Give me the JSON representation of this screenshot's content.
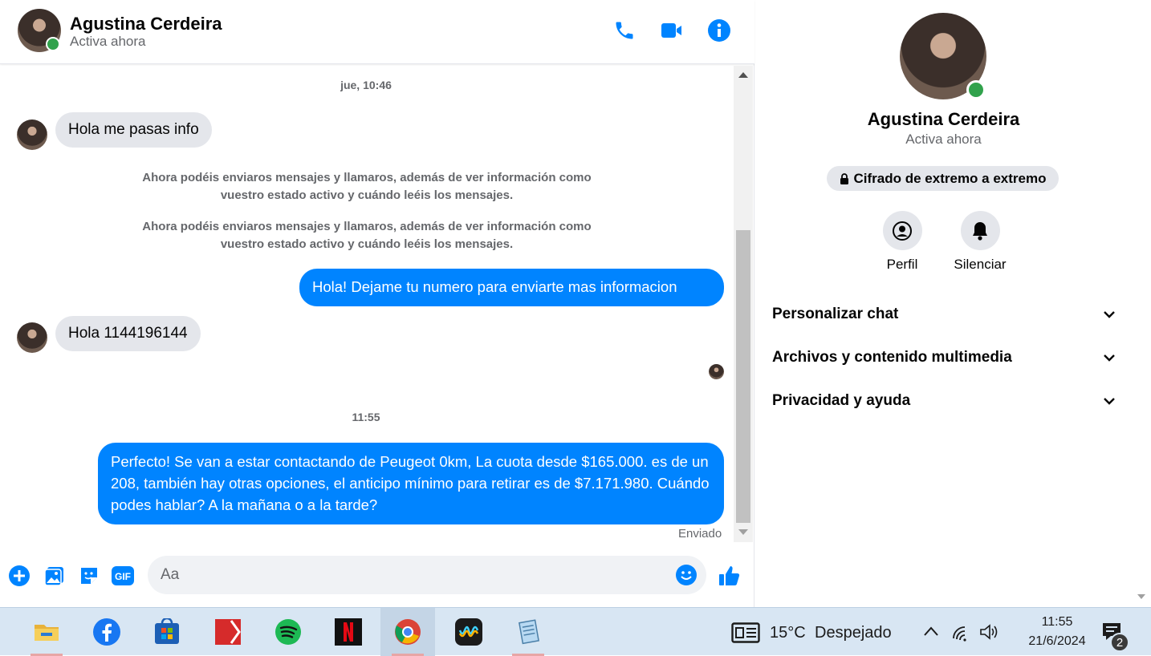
{
  "contact": {
    "name": "Agustina Cerdeira",
    "status": "Activa ahora"
  },
  "header_icons": [
    "phone-icon",
    "video-camera-icon",
    "info-icon"
  ],
  "thread": {
    "timestamp_1": "jue, 10:46",
    "msg_in_1": "Hola me pasas info",
    "system_1": "Ahora podéis enviaros mensajes y llamaros, además de ver información como vuestro estado activo y cuándo leéis los mensajes.",
    "system_2": "Ahora podéis enviaros mensajes y llamaros, además de ver información como vuestro estado activo y cuándo leéis los mensajes.",
    "msg_out_1": "Hola! Dejame tu numero para enviarte mas informacion",
    "msg_in_2": "Hola 1144196144",
    "timestamp_2": "11:55",
    "msg_out_2": "Perfecto!  Se van a estar contactando de Peugeot 0km, La cuota desde $165.000. es de un 208, también hay otras opciones, el anticipo mínimo para retirar es de $7.171.980. Cuándo podes hablar? A la mañana o a la tarde?",
    "sent_status": "Enviado"
  },
  "composer": {
    "placeholder": "Aa",
    "icons": [
      "add-icon",
      "image-icon",
      "sticker-icon",
      "gif-icon",
      "emoji-icon",
      "like-icon"
    ],
    "gif_label": "GIF"
  },
  "details": {
    "encryption": "Cifrado de extremo a extremo",
    "actions": [
      {
        "label": "Perfil",
        "icon": "profile-icon"
      },
      {
        "label": "Silenciar",
        "icon": "bell-icon"
      }
    ],
    "sections": [
      {
        "label": "Personalizar chat"
      },
      {
        "label": "Archivos y contenido multimedia"
      },
      {
        "label": "Privacidad y ayuda"
      }
    ]
  },
  "taskbar": {
    "apps": [
      "file-explorer-icon",
      "facebook-icon",
      "microsoft-store-icon",
      "pdf-editor-icon",
      "spotify-icon",
      "netflix-icon",
      "chrome-icon",
      "app-icon",
      "notepad-icon"
    ],
    "weather_temp": "15°C",
    "weather_desc": "Despejado",
    "time": "11:55",
    "date": "21/6/2024",
    "notification_count": "2"
  },
  "colors": {
    "accent": "#0084ff",
    "online": "#31a24c",
    "incoming_bubble": "#e4e6eb",
    "taskbar": "#d8e6f3"
  }
}
